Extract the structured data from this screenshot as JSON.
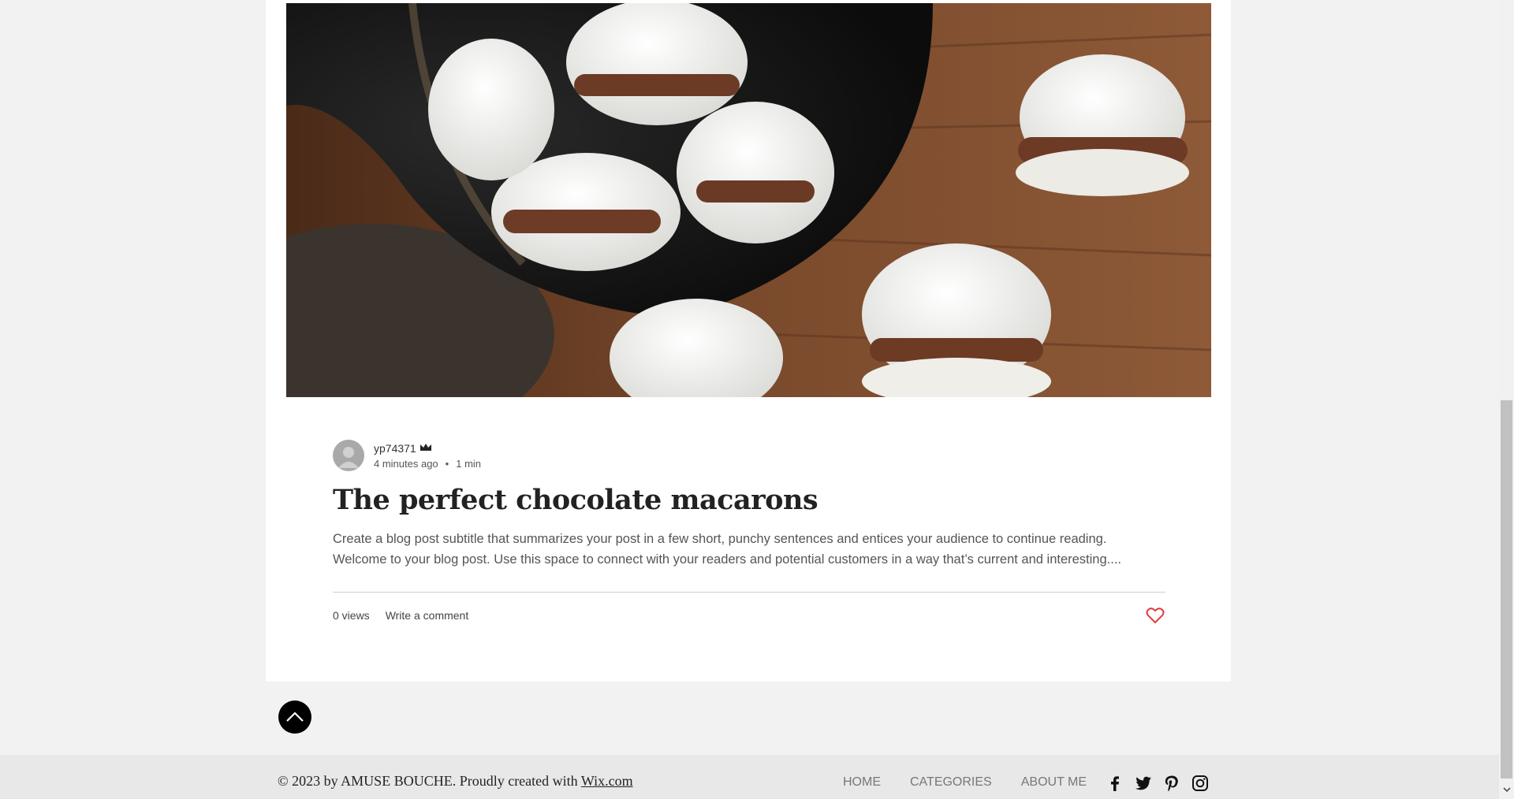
{
  "post": {
    "author": "yp74371",
    "time_ago": "4 minutes ago",
    "separator": "•",
    "read_time": "1 min",
    "title": "The perfect chocolate macarons",
    "excerpt_line1": "Create a blog post subtitle that summarizes your post in a few short, punchy sentences and entices your audience to continue reading.",
    "excerpt_line2": "Welcome to your blog post. Use this space to connect with your readers and potential customers in a way that’s current and interesting....",
    "views": "0 views",
    "comment_link": "Write a comment"
  },
  "footer": {
    "copyright": "© 2023 by AMUSE BOUCHE. Proudly created with",
    "wix_link": "Wix.com",
    "nav": [
      "HOME",
      "CATEGORIES",
      "ABOUT ME"
    ]
  },
  "icons": {
    "crown": "crown-icon",
    "heart": "heart-icon",
    "back_to_top": "chevron-up-icon",
    "social": [
      "facebook-icon",
      "twitter-icon",
      "pinterest-icon",
      "instagram-icon"
    ]
  },
  "colors": {
    "page_bg": "#f2f2f2",
    "card_bg": "#ffffff",
    "heart": "#e03e3e",
    "footer_bg": "#e8e8e8"
  }
}
